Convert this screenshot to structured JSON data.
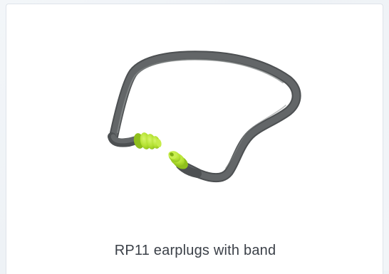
{
  "product": {
    "caption": "RP11 earplugs with band"
  },
  "colors": {
    "band": "#5c5f60",
    "band_highlight": "#8a8e8f",
    "plug": "#b5e233",
    "plug_shade": "#8fbf1c"
  },
  "icons": {
    "product_image": "earplugs-with-band-illustration"
  }
}
